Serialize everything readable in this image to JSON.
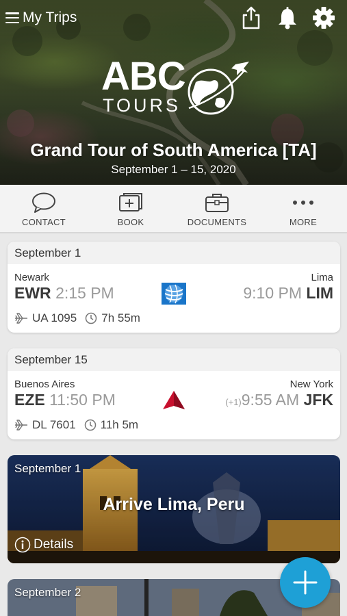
{
  "header": {
    "title": "My Trips",
    "icons": {
      "menu": "menu-icon",
      "share": "share-icon",
      "notifications": "bell-icon",
      "settings": "gear-icon"
    }
  },
  "logo": {
    "abc": "ABC",
    "tours": "TOURS"
  },
  "trip": {
    "name": "Grand Tour of South America [TA]",
    "dates": "September 1 – 15, 2020"
  },
  "actions": [
    {
      "label": "CONTACT",
      "icon": "chat-bubble-icon"
    },
    {
      "label": "BOOK",
      "icon": "book-add-icon"
    },
    {
      "label": "DOCUMENTS",
      "icon": "briefcase-icon"
    },
    {
      "label": "MORE",
      "icon": "more-dots-icon"
    }
  ],
  "flights": [
    {
      "date": "September 1",
      "from_city": "Newark",
      "from_code": "EWR",
      "depart_time": "2:15 PM",
      "to_city": "Lima",
      "to_code": "LIM",
      "arrive_time": "9:10 PM",
      "day_offset": "",
      "flight_number": "UA 1095",
      "duration": "7h 55m",
      "airline_icon": "united-globe-icon",
      "airline_color": "#1a75c9"
    },
    {
      "date": "September 15",
      "from_city": "Buenos Aires",
      "from_code": "EZE",
      "depart_time": "11:50 PM",
      "to_city": "New York",
      "to_code": "JFK",
      "arrive_time": "9:55 AM",
      "day_offset": "(+1)",
      "flight_number": "DL 7601",
      "duration": "11h 5m",
      "airline_icon": "delta-triangle-icon",
      "airline_color": "#c8102e"
    }
  ],
  "events": [
    {
      "date": "September 1",
      "title": "Arrive Lima, Peru",
      "details_label": "Details"
    },
    {
      "date": "September 2"
    }
  ],
  "fab": {
    "icon": "plus-icon",
    "color": "#1ea0d6"
  }
}
